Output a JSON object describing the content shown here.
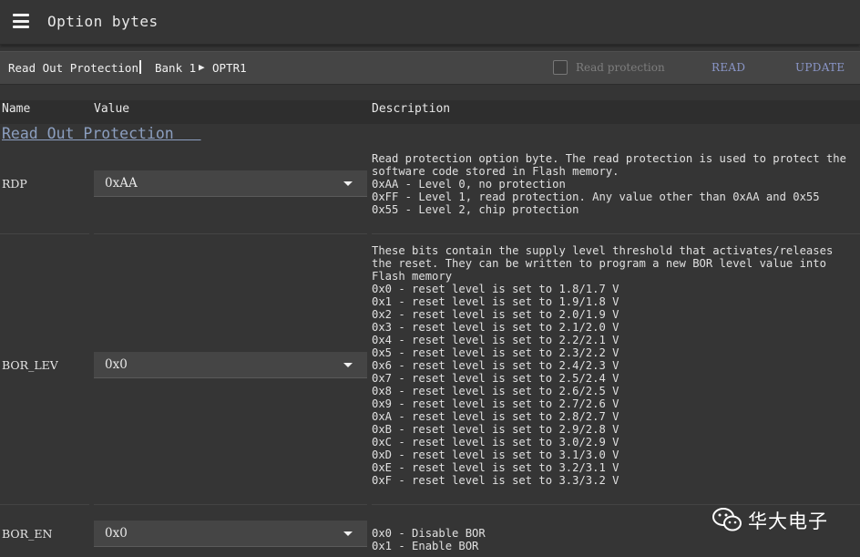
{
  "app": {
    "title": "Option bytes"
  },
  "toolbar": {
    "crumb_section": "Read Out Protection",
    "crumb_bank": "Bank 1",
    "crumb_register": "OPTR1",
    "read_protection_label": "Read protection",
    "read_label": "READ",
    "update_label": "UPDATE"
  },
  "table": {
    "col_name": "Name",
    "col_value": "Value",
    "col_desc": "Description"
  },
  "section": {
    "title": "Read Out Protection   "
  },
  "rows": [
    {
      "name": "RDP",
      "value": "0xAA",
      "description": "Read protection option byte. The read protection is used to protect the software code stored in Flash memory.\n0xAA - Level 0, no protection\n0xFF - Level 1, read protection. Any value other than 0xAA and 0x55\n0x55 - Level 2, chip protection"
    },
    {
      "name": "BOR_LEV",
      "value": "0x0",
      "description": "These bits contain the supply level threshold that activates/releases the reset. They can be written to program a new BOR level value into Flash memory\n0x0 - reset level is set to 1.8/1.7 V\n0x1 - reset level is set to 1.9/1.8 V\n0x2 - reset level is set to 2.0/1.9 V\n0x3 - reset level is set to 2.1/2.0 V\n0x4 - reset level is set to 2.2/2.1 V\n0x5 - reset level is set to 2.3/2.2 V\n0x6 - reset level is set to 2.4/2.3 V\n0x7 - reset level is set to 2.5/2.4 V\n0x8 - reset level is set to 2.6/2.5 V\n0x9 - reset level is set to 2.7/2.6 V\n0xA - reset level is set to 2.8/2.7 V\n0xB - reset level is set to 2.9/2.8 V\n0xC - reset level is set to 3.0/2.9 V\n0xD - reset level is set to 3.1/3.0 V\n0xE - reset level is set to 3.2/3.1 V\n0xF - reset level is set to 3.3/3.2 V"
    },
    {
      "name": "BOR_EN",
      "value": "0x0",
      "description": "0x0 - Disable BOR\n0x1 - Enable BOR"
    }
  ],
  "watermark": {
    "text": "华大电子",
    "icon": "wechat-icon"
  }
}
